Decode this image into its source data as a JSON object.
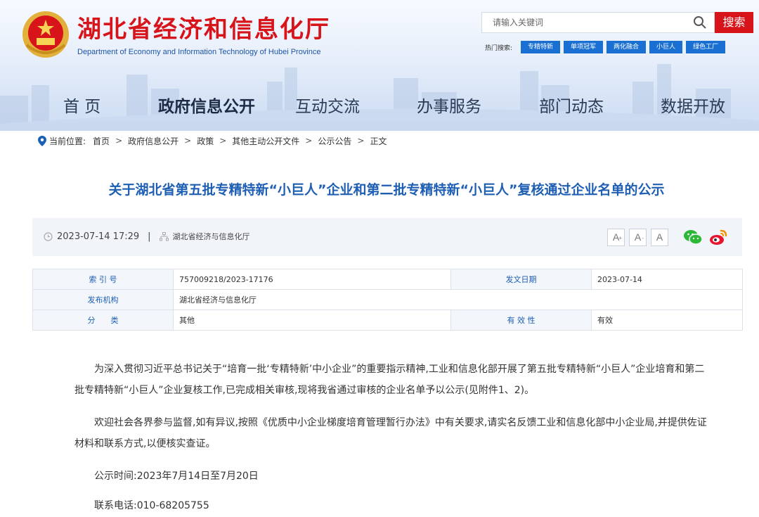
{
  "header": {
    "site_title": "湖北省经济和信息化厅",
    "site_subtitle": "Department of Economy and Information Technology of Hubei Province",
    "search_placeholder": "请输入关键词",
    "search_button": "搜索",
    "hot_label": "热门搜索:",
    "hot_tags": [
      "专精特新",
      "单项冠军",
      "两化融合",
      "小巨人",
      "绿色工厂"
    ]
  },
  "nav": {
    "items": [
      "首 页",
      "政府信息公开",
      "互动交流",
      "办事服务",
      "部门动态",
      "数据开放"
    ]
  },
  "breadcrumb": {
    "label": "当前位置:",
    "items": [
      "首页",
      "政府信息公开",
      "政策",
      "其他主动公开文件",
      "公示公告",
      "正文"
    ]
  },
  "article": {
    "title": "关于湖北省第五批专精特新“小巨人”企业和第二批专精特新“小巨人”复核通过企业名单的公示",
    "datetime": "2023-07-14 17:29",
    "separator": "|",
    "source": "湖北省经济与信息化厅",
    "font_buttons": [
      "A",
      "A",
      "A"
    ]
  },
  "info_table": {
    "rows": [
      {
        "k1": "索 引 号",
        "v1": "757009218/2023-17176",
        "k2": "发文日期",
        "v2": "2023-07-14"
      },
      {
        "k1": "发布机构",
        "v1": "湖北省经济与信息化厅"
      },
      {
        "k1": "分　　类",
        "v1": "其他",
        "k2": "有 效 性",
        "v2": "有效"
      }
    ]
  },
  "content": {
    "p1": "为深入贯彻习近平总书记关于“培育一批‘专精特新’中小企业”的重要指示精神,工业和信息化部开展了第五批专精特新“小巨人”企业培育和第二批专精特新“小巨人”企业复核工作,已完成相关审核,现将我省通过审核的企业名单予以公示(见附件1、2)。",
    "p2": "欢迎社会各界参与监督,如有异议,按照《优质中小企业梯度培育管理暂行办法》中有关要求,请实名反馈工业和信息化部中小企业局,并提供佐证材料和联系方式,以便核实查证。",
    "p3": "公示时间:2023年7月14日至7月20日",
    "p4": "联系电话:010-68205755"
  },
  "colors": {
    "brand_red": "#d7141a",
    "link_blue": "#1e5fb4",
    "tag_blue": "#1a6fd3"
  },
  "icons": [
    "emblem-logo",
    "search-icon",
    "location-pin-icon",
    "clock-icon",
    "org-icon",
    "wechat-icon",
    "weibo-icon"
  ]
}
